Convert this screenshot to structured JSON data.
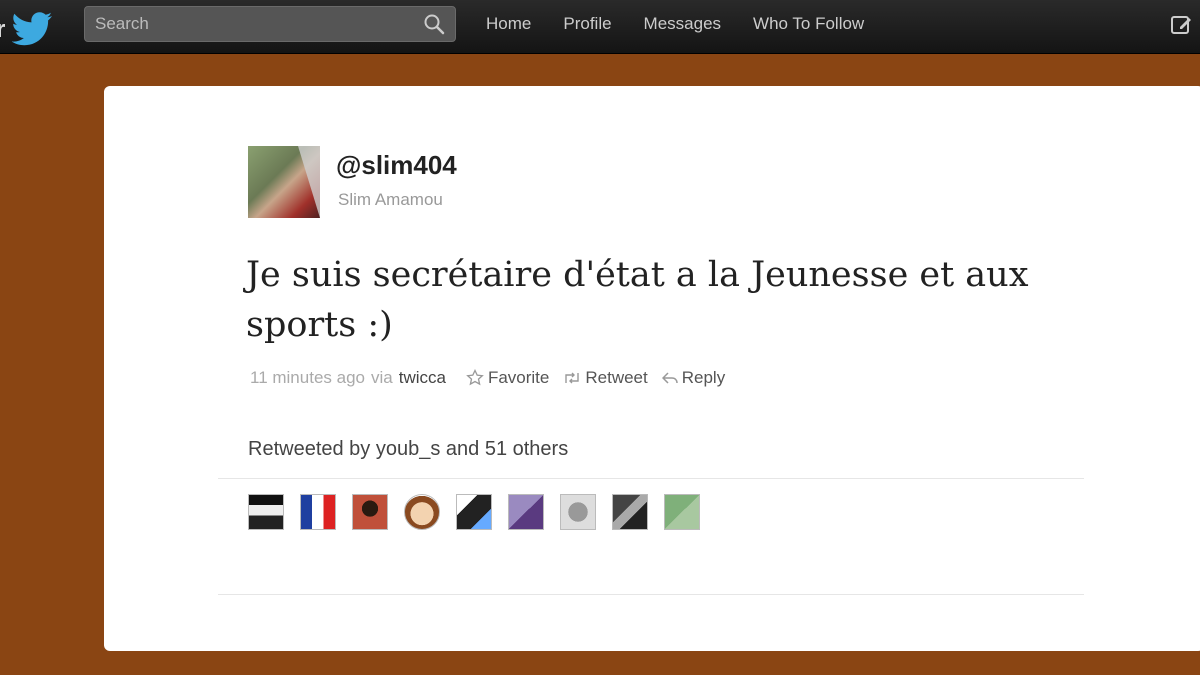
{
  "topbar": {
    "logo_text": "r",
    "search": {
      "placeholder": "Search"
    },
    "nav": [
      "Home",
      "Profile",
      "Messages",
      "Who To Follow"
    ]
  },
  "tweet": {
    "handle": "@slim404",
    "name": "Slim Amamou",
    "text": "Je suis secrétaire d'état a la Jeunesse et aux sports :)",
    "time": "11 minutes ago",
    "via_label": "via",
    "via_app": "twicca",
    "actions": {
      "favorite": "Favorite",
      "retweet": "Retweet",
      "reply": "Reply"
    },
    "retweeted_by": "Retweeted by youb_s and 51 others"
  },
  "colors": {
    "background": "#8a4513",
    "topbar": "#1b1b1b",
    "card": "#ffffff"
  },
  "icons": [
    "twitter-bird-icon",
    "search-icon",
    "compose-icon",
    "star-icon",
    "retweet-icon",
    "reply-icon"
  ]
}
